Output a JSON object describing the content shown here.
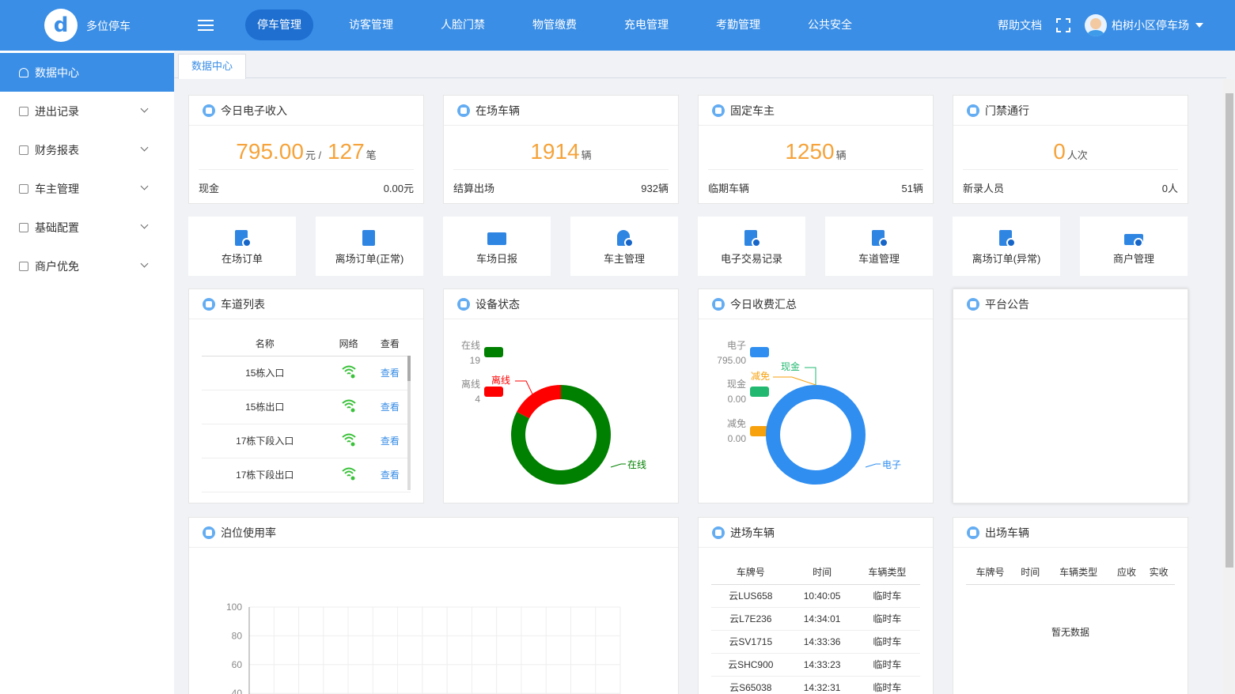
{
  "app": {
    "brand": "多位停车",
    "logo_letter": "d"
  },
  "nav": {
    "items": [
      "停车管理",
      "访客管理",
      "人脸门禁",
      "物管缴费",
      "充电管理",
      "考勤管理",
      "公共安全"
    ]
  },
  "header": {
    "help": "帮助文档",
    "user": "柏树小区停车场"
  },
  "sidebar": {
    "items": [
      "数据中心",
      "进出记录",
      "财务报表",
      "车主管理",
      "基础配置",
      "商户优免"
    ]
  },
  "tabs": [
    "数据中心"
  ],
  "stats": {
    "income": {
      "title": "今日电子收入",
      "amount": "795.00",
      "unit1": "元 /",
      "count": "127",
      "unit2": "笔",
      "sub_label": "现金",
      "sub_value": "0.00元"
    },
    "vehicles": {
      "title": "在场车辆",
      "value": "1914",
      "unit": "辆",
      "sub_label": "结算出场",
      "sub_value": "932辆"
    },
    "owners": {
      "title": "固定车主",
      "value": "1250",
      "unit": "辆",
      "sub_label": "临期车辆",
      "sub_value": "51辆"
    },
    "access": {
      "title": "门禁通行",
      "value": "0",
      "unit": "人次",
      "sub_label": "新录人员",
      "sub_value": "0人"
    }
  },
  "quick": [
    "在场订单",
    "离场订单(正常)",
    "车场日报",
    "车主管理",
    "电子交易记录",
    "车道管理",
    "离场订单(异常)",
    "商户管理"
  ],
  "lanes": {
    "title": "车道列表",
    "columns": [
      "名称",
      "网络",
      "查看"
    ],
    "rows": [
      {
        "name": "15栋入口",
        "view": "查看"
      },
      {
        "name": "15栋出口",
        "view": "查看"
      },
      {
        "name": "17栋下段入口",
        "view": "查看"
      },
      {
        "name": "17栋下段出口",
        "view": "查看"
      }
    ]
  },
  "devices": {
    "title": "设备状态",
    "legend": [
      {
        "label": "在线",
        "value": "19",
        "color": "#008000"
      },
      {
        "label": "离线",
        "value": "4",
        "color": "#ff0000"
      }
    ]
  },
  "fees": {
    "title": "今日收费汇总",
    "legend": [
      {
        "label": "电子",
        "value": "795.00",
        "color": "#2f8ef0"
      },
      {
        "label": "现金",
        "value": "0.00",
        "color": "#22b870"
      },
      {
        "label": "减免",
        "value": "0.00",
        "color": "#f7a10d"
      }
    ]
  },
  "notice": {
    "title": "平台公告"
  },
  "occupancy": {
    "title": "泊位使用率",
    "y_ticks": [
      "100",
      "80",
      "60",
      "40"
    ]
  },
  "entries": {
    "title": "进场车辆",
    "columns": [
      "车牌号",
      "时间",
      "车辆类型"
    ],
    "rows": [
      [
        "云LUS658",
        "10:40:05",
        "临时车"
      ],
      [
        "云L7E236",
        "14:34:01",
        "临时车"
      ],
      [
        "云SV1715",
        "14:33:36",
        "临时车"
      ],
      [
        "云SHC900",
        "14:33:23",
        "临时车"
      ],
      [
        "云S65038",
        "14:32:31",
        "临时车"
      ]
    ]
  },
  "exits": {
    "title": "出场车辆",
    "columns": [
      "车牌号",
      "时间",
      "车辆类型",
      "应收",
      "实收"
    ],
    "empty": "暂无数据"
  },
  "chart_data": [
    {
      "type": "pie",
      "title": "设备状态",
      "labels": [
        "在线",
        "离线"
      ],
      "values": [
        19,
        4
      ],
      "colors": [
        "#008000",
        "#ff0000"
      ],
      "legend": "left"
    },
    {
      "type": "pie",
      "title": "今日收费汇总",
      "labels": [
        "电子",
        "现金",
        "减免"
      ],
      "values": [
        795.0,
        0.0,
        0.0
      ],
      "colors": [
        "#2f8ef0",
        "#22b870",
        "#f7a10d"
      ],
      "legend": "left"
    },
    {
      "type": "bar",
      "title": "泊位使用率",
      "ylim": [
        0,
        100
      ],
      "y_ticks": [
        100,
        80,
        60,
        40
      ],
      "grid": true,
      "categories": [],
      "values": []
    }
  ]
}
